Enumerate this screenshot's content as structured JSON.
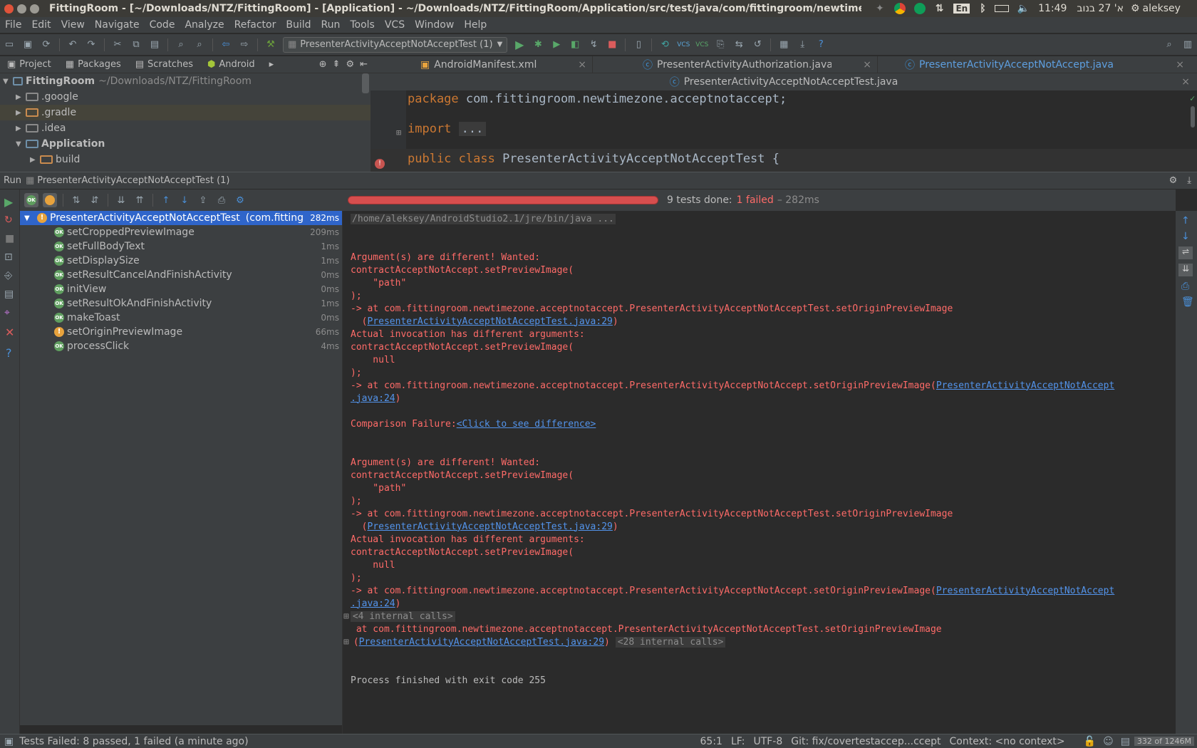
{
  "titlebar": {
    "title": "FittingRoom - [~/Downloads/NTZ/FittingRoom] - [Application] - ~/Downloads/NTZ/FittingRoom/Application/src/test/java/com/fittingroom/newtimezone/ac",
    "lang": "En",
    "time": "11:49",
    "date": "א' 27 בנוב",
    "user": "aleksey"
  },
  "menu": [
    "File",
    "Edit",
    "View",
    "Navigate",
    "Code",
    "Analyze",
    "Refactor",
    "Build",
    "Run",
    "Tools",
    "VCS",
    "Window",
    "Help"
  ],
  "toolbar": {
    "run_config": "PresenterActivityAcceptNotAcceptTest (1)"
  },
  "project_tabs": [
    "Project",
    "Packages",
    "Scratches",
    "Android"
  ],
  "tree": {
    "root_name": "FittingRoom",
    "root_path": "~/Downloads/NTZ/FittingRoom",
    "items": [
      ".google",
      ".gradle",
      ".idea",
      "Application",
      "build"
    ]
  },
  "editor_tabs": [
    "AndroidManifest.xml",
    "PresenterActivityAuthorization.java",
    "PresenterActivityAcceptNotAccept.java"
  ],
  "editor_tab_active": "PresenterActivityAcceptNotAcceptTest.java",
  "code": {
    "line1_kw": "package",
    "line1_rest": " com.fittingroom.newtimezone.acceptnotaccept;",
    "line2_kw": "import",
    "line2_rest": "...",
    "line3_kw": "public class",
    "line3_rest": " PresenterActivityAcceptNotAcceptTest {"
  },
  "run": {
    "label": "Run",
    "tab": "PresenterActivityAcceptNotAcceptTest (1)",
    "summary": "9 tests done:",
    "failed": "1 failed",
    "duration": "– 282ms"
  },
  "tests": {
    "root": {
      "name": "PresenterActivityAcceptNotAcceptTest",
      "pkg": "(com.fitting",
      "time": "282ms"
    },
    "items": [
      {
        "name": "setCroppedPreviewImage",
        "time": "209ms",
        "status": "ok"
      },
      {
        "name": "setFullBodyText",
        "time": "1ms",
        "status": "ok"
      },
      {
        "name": "setDisplaySize",
        "time": "1ms",
        "status": "ok"
      },
      {
        "name": "setResultCancelAndFinishActivity",
        "time": "0ms",
        "status": "ok"
      },
      {
        "name": "initView",
        "time": "0ms",
        "status": "ok"
      },
      {
        "name": "setResultOkAndFinishActivity",
        "time": "1ms",
        "status": "ok"
      },
      {
        "name": "makeToast",
        "time": "0ms",
        "status": "ok"
      },
      {
        "name": "setOriginPreviewImage",
        "time": "66ms",
        "status": "fail"
      },
      {
        "name": "processClick",
        "time": "4ms",
        "status": "ok"
      }
    ]
  },
  "console": {
    "cmd": "/home/aleksey/AndroidStudio2.1/jre/bin/java ...",
    "wanted": "Argument(s) are different! Wanted:",
    "call": "contractAcceptNotAccept.setPreviewImage(",
    "path_arg": "    \"path\"",
    "close": ");",
    "at_test": "-> at com.fittingroom.newtimezone.acceptnotaccept.PresenterActivityAcceptNotAcceptTest.setOriginPreviewImage",
    "test_link": "PresenterActivityAcceptNotAcceptTest.java:29",
    "actual": "Actual invocation has different arguments:",
    "null_arg": "    null",
    "at_impl": "-> at com.fittingroom.newtimezone.acceptnotaccept.PresenterActivityAcceptNotAccept.setOriginPreviewImage(",
    "impl_link_a": "PresenterActivityAcceptNotAccept",
    "impl_link_b": ".java:24",
    "comparison": "Comparison Failure:",
    "diff_link": "<Click to see difference>",
    "internal4": "<4 internal calls>",
    "at_plain": " at com.fittingroom.newtimezone.acceptnotaccept.PresenterActivityAcceptNotAcceptTest.setOriginPreviewImage",
    "internal28": "<28 internal calls>",
    "finished": "Process finished with exit code 255"
  },
  "status": {
    "left": "Tests Failed: 8 passed, 1 failed (a minute ago)",
    "pos": "65:1",
    "lf": "LF:",
    "enc": "UTF-8",
    "git": "Git: fix/covertestaccep...ccept",
    "context": "Context: <no context>",
    "mem": "332 of 1246M"
  }
}
